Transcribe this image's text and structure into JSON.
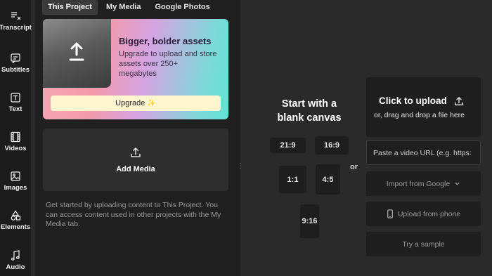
{
  "sidebar": {
    "items": [
      {
        "label": "Transcript",
        "icon": "transcript-icon"
      },
      {
        "label": "Subtitles",
        "icon": "subtitles-icon"
      },
      {
        "label": "Text",
        "icon": "text-icon"
      },
      {
        "label": "Videos",
        "icon": "film-icon"
      },
      {
        "label": "Images",
        "icon": "image-icon"
      },
      {
        "label": "Elements",
        "icon": "shapes-icon"
      },
      {
        "label": "Audio",
        "icon": "music-note-icon"
      }
    ]
  },
  "tabs": [
    {
      "label": "This Project",
      "active": true
    },
    {
      "label": "My Media",
      "active": false
    },
    {
      "label": "Google Photos",
      "active": false
    }
  ],
  "promo": {
    "title": "Bigger, bolder assets",
    "text": "Upgrade to upload and store assets over 250+ megabytes",
    "button_label": "Upgrade",
    "button_glyph": "✨"
  },
  "add_media": {
    "label": "Add Media"
  },
  "hint": "Get started by uploading content to This Project. You can access content used in other projects with the My Media tab.",
  "canvas": {
    "title": "Start with a blank canvas",
    "ratios": [
      "21:9",
      "16:9",
      "1:1",
      "4:5",
      "9:16"
    ],
    "or_label": "or"
  },
  "upload": {
    "title": "Click to upload",
    "subtitle": "or, drag and drop a file here",
    "url_placeholder": "Paste a video URL (e.g. https:",
    "import_google": "Import from Google",
    "upload_phone": "Upload from phone",
    "sample": "Try a sample"
  },
  "colors": {
    "background": "#2a2a2a",
    "panel": "#202020",
    "sidebar": "#1c1c1c",
    "upgrade_button": "#fdf4d0"
  }
}
